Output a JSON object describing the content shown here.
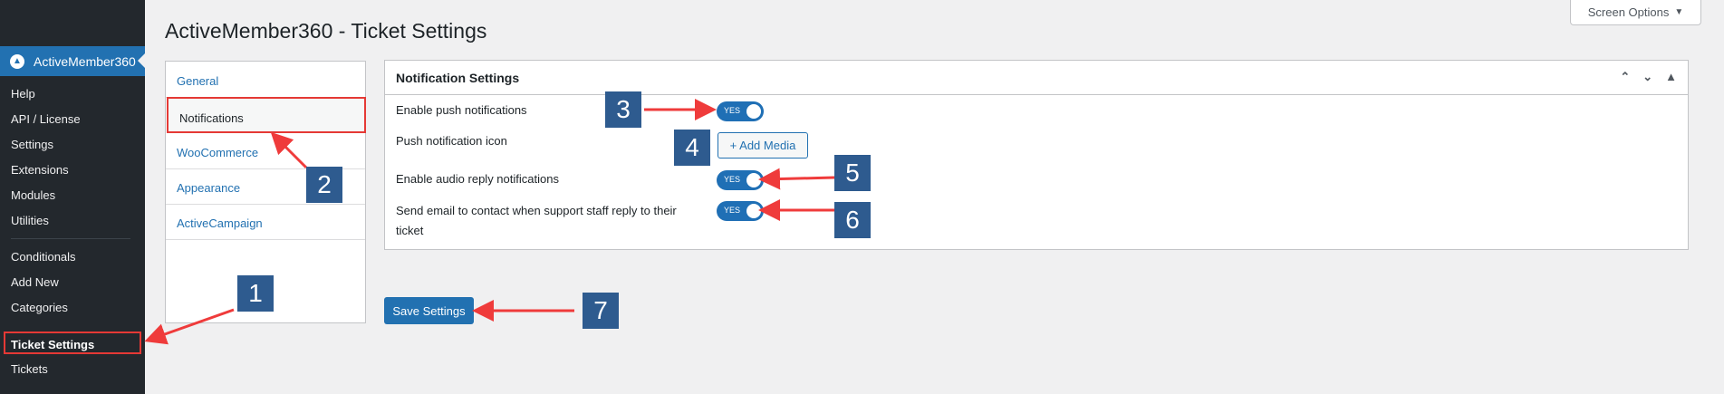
{
  "sidebar": {
    "brand": "ActiveMember360",
    "brand_icon": "activemember-logo-icon",
    "items": [
      {
        "label": "Help"
      },
      {
        "label": "API / License"
      },
      {
        "label": "Settings"
      },
      {
        "label": "Extensions"
      },
      {
        "label": "Modules"
      },
      {
        "label": "Utilities"
      },
      {
        "label": "Conditionals"
      },
      {
        "label": "Add New"
      },
      {
        "label": "Categories"
      },
      {
        "label": "Ticket Settings"
      },
      {
        "label": "Tickets"
      }
    ]
  },
  "header": {
    "title": "ActiveMember360 - Ticket Settings",
    "screen_options": "Screen Options"
  },
  "tabs": [
    {
      "label": "General"
    },
    {
      "label": "Notifications"
    },
    {
      "label": "WooCommerce"
    },
    {
      "label": "Appearance"
    },
    {
      "label": "ActiveCampaign"
    }
  ],
  "notification_box": {
    "title": "Notification Settings",
    "rows": {
      "push": {
        "label": "Enable push notifications",
        "toggle": "YES"
      },
      "icon": {
        "label": "Push notification icon",
        "button": "+ Add Media"
      },
      "audio": {
        "label": "Enable audio reply notifications",
        "toggle": "YES"
      },
      "email": {
        "label": "Send email to contact when support staff reply to their ticket",
        "label_line1": "Send email to contact when support staff reply to their",
        "label_line2": "ticket",
        "toggle": "YES"
      }
    }
  },
  "save_button": "Save Settings",
  "callouts": [
    "1",
    "2",
    "3",
    "4",
    "5",
    "6",
    "7"
  ],
  "colors": {
    "accent": "#2271b1",
    "sidebar_bg": "#23282d",
    "callout_bg": "#2e5b8f",
    "highlight_border": "#e53935",
    "arrow": "#ef3b3b"
  }
}
